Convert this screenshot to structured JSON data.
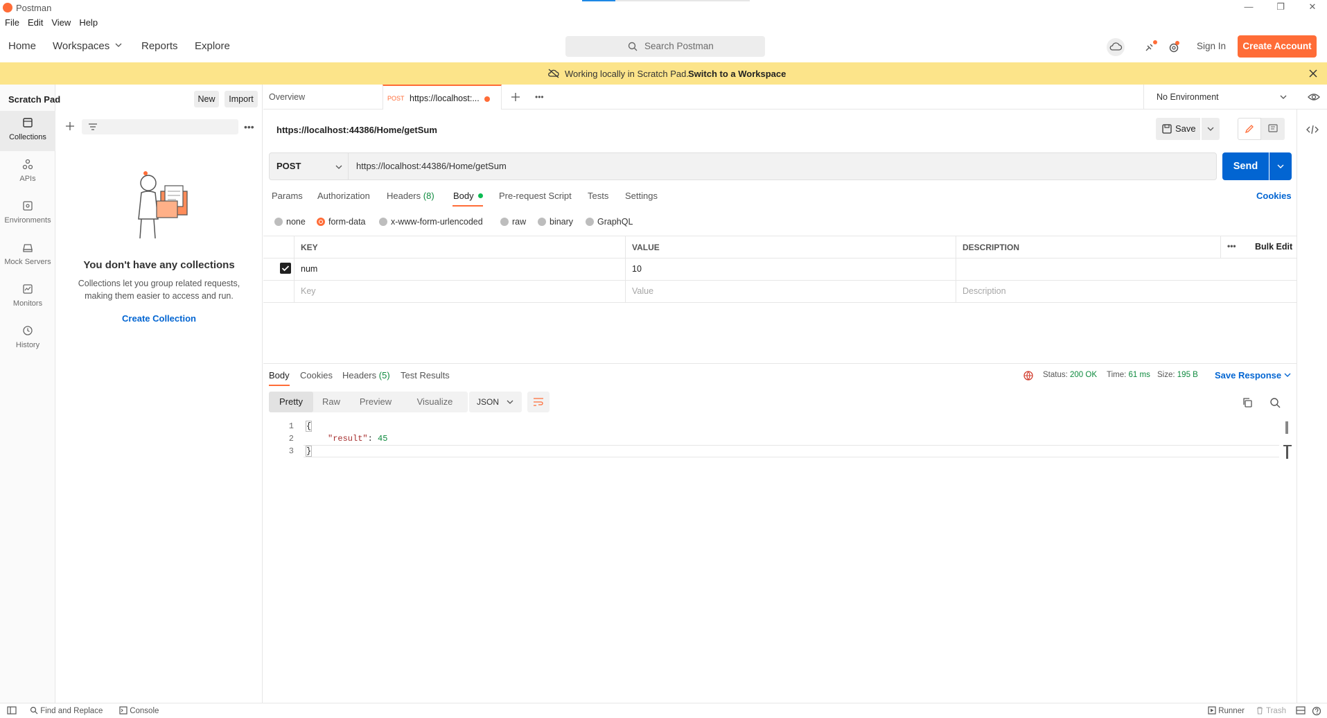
{
  "window": {
    "title": "Postman"
  },
  "menu": [
    "File",
    "Edit",
    "View",
    "Help"
  ],
  "header": {
    "nav": [
      "Home",
      "Workspaces",
      "Reports",
      "Explore"
    ],
    "search_placeholder": "Search Postman",
    "sign_in": "Sign In",
    "create_account": "Create Account"
  },
  "banner": {
    "message": "Working locally in Scratch Pad.",
    "link": "Switch to a Workspace"
  },
  "rail": [
    "Collections",
    "APIs",
    "Environments",
    "Mock Servers",
    "Monitors",
    "History"
  ],
  "sidebar": {
    "title": "Scratch Pad",
    "new_label": "New",
    "import_label": "Import",
    "empty_title": "You don't have any collections",
    "empty_desc": "Collections let you group related requests, making them easier to access and run.",
    "create_label": "Create Collection"
  },
  "tabs": {
    "overview": "Overview",
    "active_method": "POST",
    "active_label": "https://localhost:...",
    "environment": "No Environment"
  },
  "request": {
    "name": "https://localhost:44386/Home/getSum",
    "method": "POST",
    "url": "https://localhost:44386/Home/getSum",
    "save_label": "Save",
    "send_label": "Send",
    "tabs": [
      "Params",
      "Authorization",
      "Headers",
      "(8)",
      "Body",
      "Pre-request Script",
      "Tests",
      "Settings"
    ],
    "cookies_label": "Cookies",
    "body_types": [
      "none",
      "form-data",
      "x-www-form-urlencoded",
      "raw",
      "binary",
      "GraphQL"
    ],
    "selected_body_type": "form-data",
    "table": {
      "headers": [
        "KEY",
        "VALUE",
        "DESCRIPTION"
      ],
      "bulk_edit": "Bulk Edit",
      "rows": [
        {
          "checked": true,
          "key": "num",
          "value": "10",
          "description": ""
        }
      ],
      "placeholders": {
        "key": "Key",
        "value": "Value",
        "description": "Description"
      }
    }
  },
  "response": {
    "tabs": [
      "Body",
      "Cookies",
      "Headers",
      "(5)",
      "Test Results"
    ],
    "status_label": "Status:",
    "status_value": "200 OK",
    "time_label": "Time:",
    "time_value": "61 ms",
    "size_label": "Size:",
    "size_value": "195 B",
    "save_response": "Save Response",
    "view_tabs": [
      "Pretty",
      "Raw",
      "Preview",
      "Visualize"
    ],
    "format": "JSON",
    "code": {
      "line_numbers": [
        "1",
        "2",
        "3"
      ],
      "open": "{",
      "key": "\"result\"",
      "colon": ": ",
      "value": "45",
      "close": "}"
    }
  },
  "statusbar": {
    "find_replace": "Find and Replace",
    "console": "Console",
    "runner": "Runner",
    "trash": "Trash"
  },
  "colors": {
    "accent": "#ff6c37",
    "primary": "#0265d2",
    "banner": "#fce48a",
    "success": "#0e8a3e"
  }
}
